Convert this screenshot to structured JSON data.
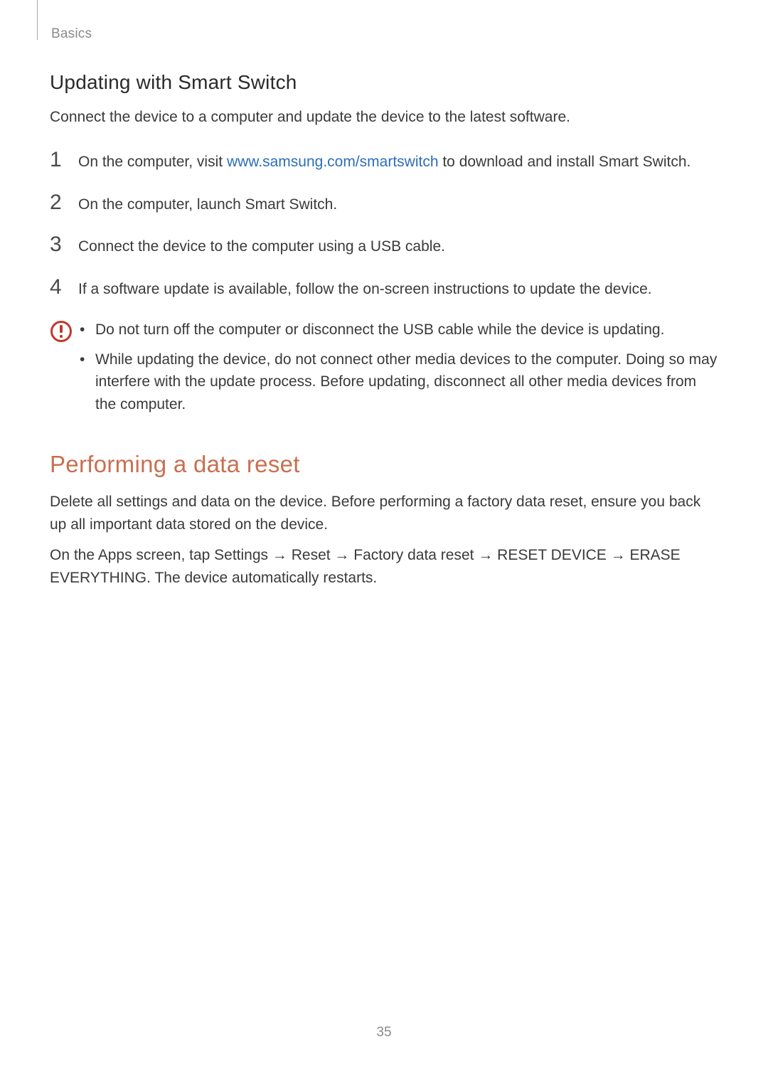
{
  "header": {
    "section": "Basics"
  },
  "section1": {
    "heading": "Updating with Smart Switch",
    "intro": "Connect the device to a computer and update the device to the latest software.",
    "steps": [
      {
        "num": "1",
        "pre": "On the computer, visit ",
        "link": "www.samsung.com/smartswitch",
        "post": " to download and install Smart Switch."
      },
      {
        "num": "2",
        "text": "On the computer, launch Smart Switch."
      },
      {
        "num": "3",
        "text": "Connect the device to the computer using a USB cable."
      },
      {
        "num": "4",
        "text": "If a software update is available, follow the on-screen instructions to update the device."
      }
    ],
    "cautions": [
      "Do not turn off the computer or disconnect the USB cable while the device is updating.",
      "While updating the device, do not connect other media devices to the computer. Doing so may interfere with the update process. Before updating, disconnect all other media devices from the computer."
    ]
  },
  "section2": {
    "heading": "Performing a data reset",
    "para1": "Delete all settings and data on the device. Before performing a factory data reset, ensure you back up all important data stored on the device.",
    "para2": {
      "pre": "On the Apps screen, tap ",
      "p1": "Settings",
      "arrow": " → ",
      "p2": "Reset",
      "p3": "Factory data reset",
      "p4": "RESET DEVICE",
      "p5": "ERASE EVERYTHING",
      "post": ". The device automatically restarts."
    }
  },
  "pageNumber": "35"
}
